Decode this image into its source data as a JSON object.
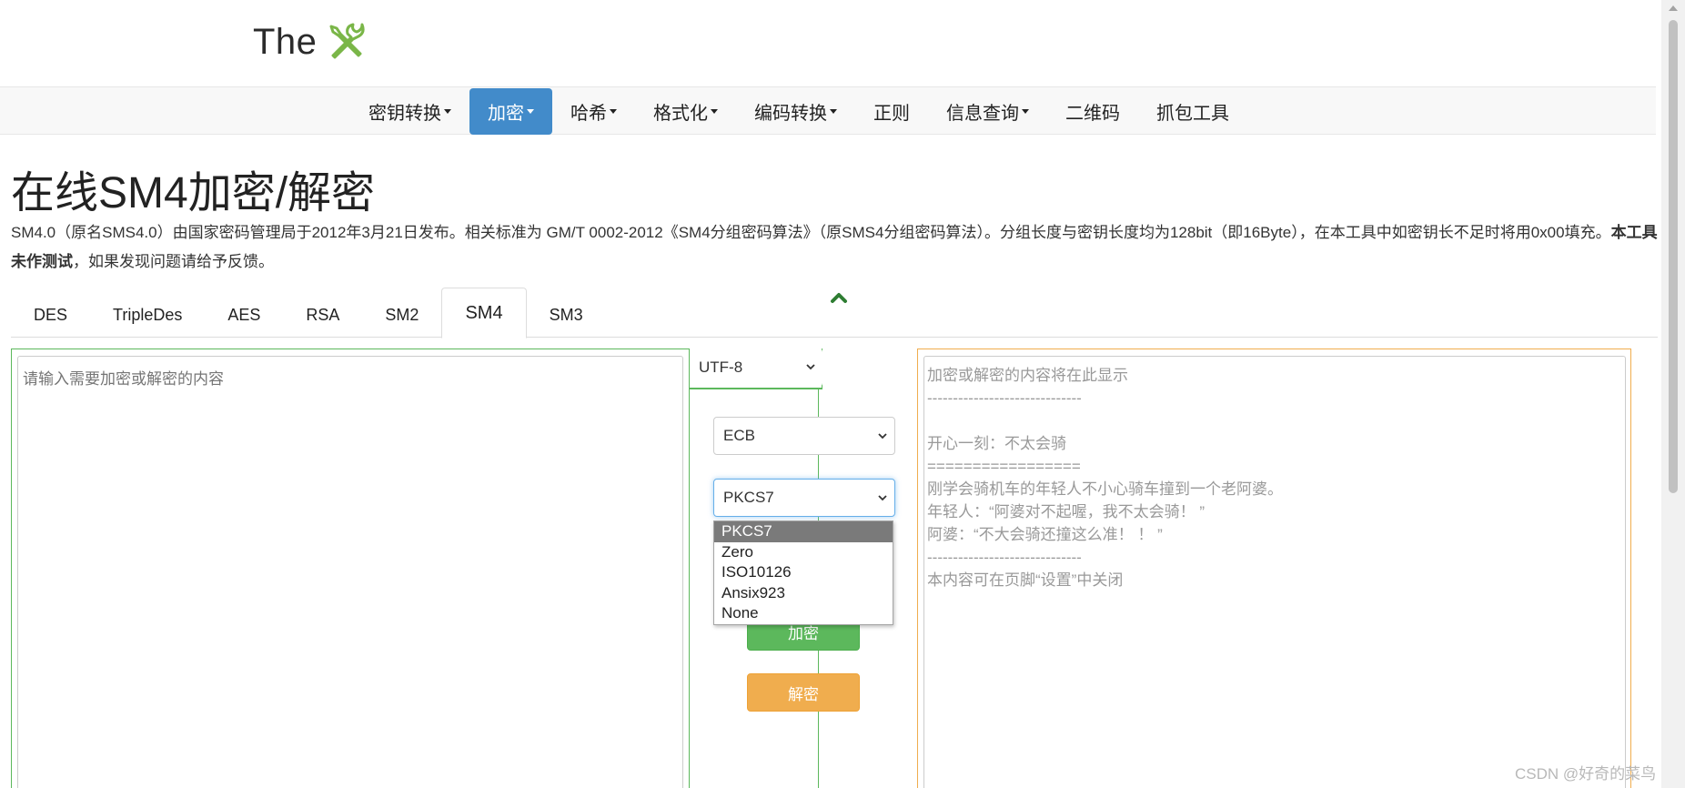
{
  "brand": {
    "text": "The",
    "icon": "tools-icon"
  },
  "nav": {
    "items": [
      {
        "label": "密钥转换",
        "dropdown": true,
        "active": false
      },
      {
        "label": "加密",
        "dropdown": true,
        "active": true
      },
      {
        "label": "哈希",
        "dropdown": true,
        "active": false
      },
      {
        "label": "格式化",
        "dropdown": true,
        "active": false
      },
      {
        "label": "编码转换",
        "dropdown": true,
        "active": false
      },
      {
        "label": "正则",
        "dropdown": false,
        "active": false
      },
      {
        "label": "信息查询",
        "dropdown": true,
        "active": false
      },
      {
        "label": "二维码",
        "dropdown": false,
        "active": false
      },
      {
        "label": "抓包工具",
        "dropdown": false,
        "active": false
      }
    ]
  },
  "page": {
    "title": "在线SM4加密/解密",
    "desc_part1": "SM4.0（原名SMS4.0）由国家密码管理局于2012年3月21日发布。相关标准为 GM/T 0002-2012《SM4分组密码算法》（原SMS4分组密码算法）。分组长度与密钥长度均为128bit（即16Byte），在本工具中如密钥长不足时将用0x00填充。",
    "desc_bold": "本工具未作测试",
    "desc_part2": "，如果发现问题请给予反馈。"
  },
  "tabs": [
    {
      "label": "DES",
      "active": false
    },
    {
      "label": "TripleDes",
      "active": false
    },
    {
      "label": "AES",
      "active": false
    },
    {
      "label": "RSA",
      "active": false
    },
    {
      "label": "SM2",
      "active": false
    },
    {
      "label": "SM4",
      "active": true
    },
    {
      "label": "SM3",
      "active": false
    }
  ],
  "input": {
    "placeholder": "请输入需要加密或解密的内容",
    "value": ""
  },
  "controls": {
    "encoding": "UTF-8",
    "mode": "ECB",
    "padding": "PKCS7",
    "padding_options": [
      "PKCS7",
      "Zero",
      "ISO10126",
      "Ansix923",
      "None"
    ],
    "encrypt_label": "加密",
    "decrypt_label": "解密"
  },
  "output": {
    "text": "加密或解密的内容将在此显示\n------------------------------\n\n开心一刻：不太会骑\n=================\n刚学会骑机车的年轻人不小心骑车撞到一个老阿婆。\n年轻人：“阿婆对不起喔，我不太会骑！ ”\n阿婆：“不大会骑还撞这么准！ ！ ”\n------------------------------\n本内容可在页脚“设置”中关闭"
  },
  "colors": {
    "primary": "#428bca",
    "success": "#5cb85c",
    "warning": "#f0ad4e",
    "brand_icon": "#8cc63f"
  },
  "watermark": "CSDN @好奇的菜鸟"
}
